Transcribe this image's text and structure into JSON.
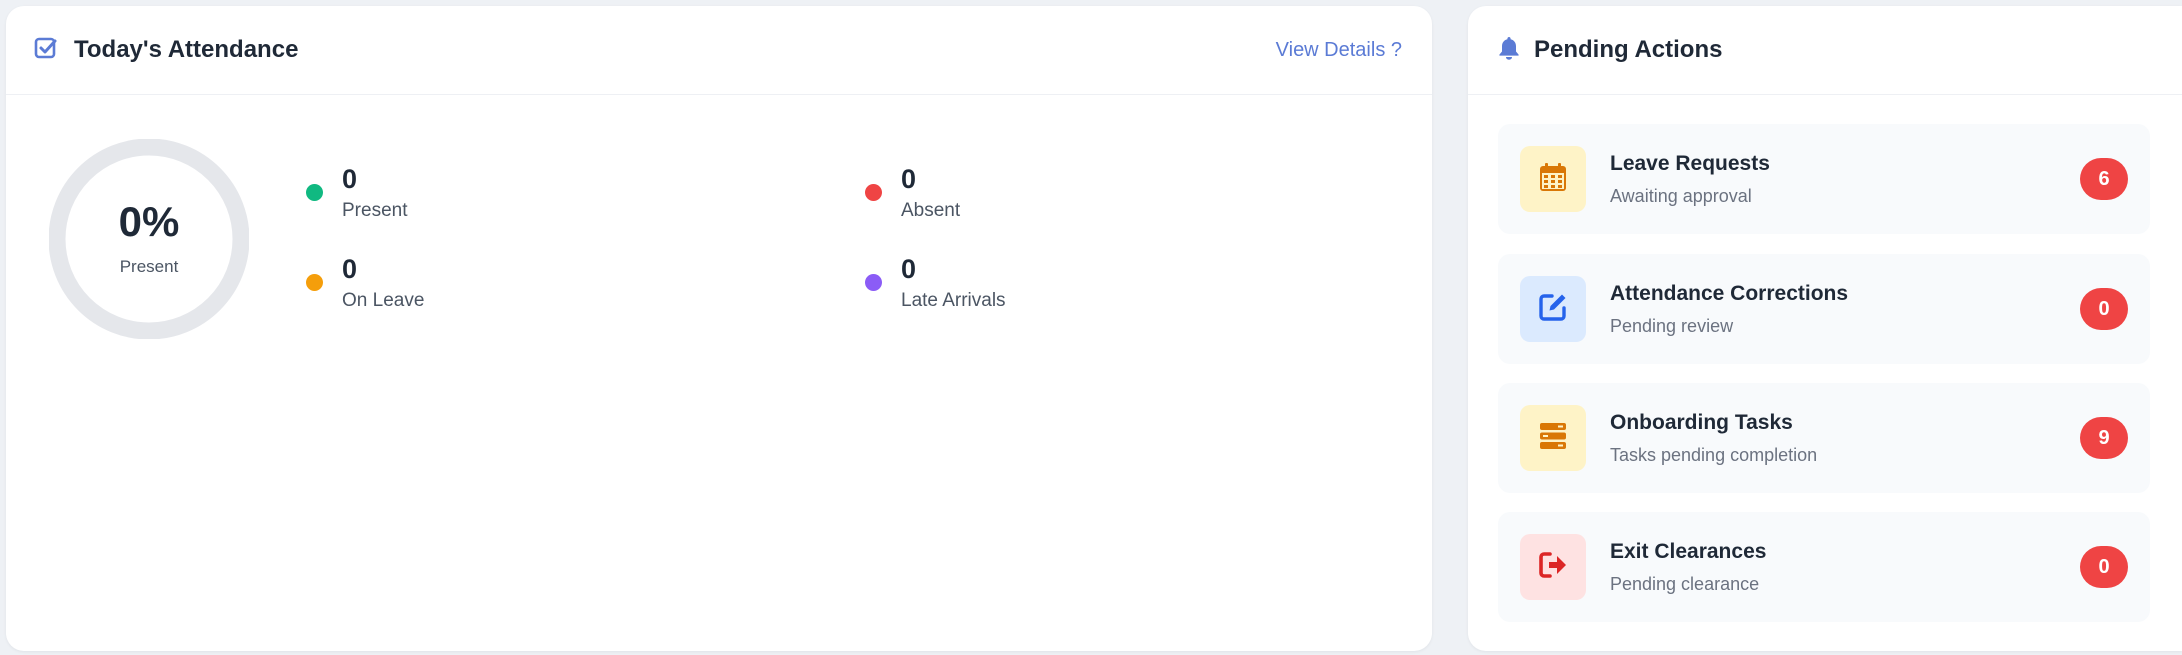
{
  "attendance": {
    "title": "Today's Attendance",
    "view_details": "View Details ?",
    "rate": {
      "value": "0%",
      "label": "Present",
      "fraction": 0
    },
    "stats": [
      {
        "value": "0",
        "label": "Present",
        "color": "#10b981"
      },
      {
        "value": "0",
        "label": "Absent",
        "color": "#ef4444"
      },
      {
        "value": "0",
        "label": "On Leave",
        "color": "#f59e0b"
      },
      {
        "value": "0",
        "label": "Late Arrivals",
        "color": "#8b5cf6"
      }
    ]
  },
  "pending": {
    "title": "Pending Actions",
    "items": [
      {
        "title": "Leave Requests",
        "subtitle": "Awaiting approval",
        "count": "6",
        "icon": "calendar-icon",
        "icon_color": "#d97706",
        "icon_bg": "#fef3c7"
      },
      {
        "title": "Attendance Corrections",
        "subtitle": "Pending review",
        "count": "0",
        "icon": "edit-icon",
        "icon_color": "#2563eb",
        "icon_bg": "#dbeafe"
      },
      {
        "title": "Onboarding Tasks",
        "subtitle": "Tasks pending completion",
        "count": "9",
        "icon": "tasks-icon",
        "icon_color": "#d97706",
        "icon_bg": "#fef3c7"
      },
      {
        "title": "Exit Clearances",
        "subtitle": "Pending clearance",
        "count": "0",
        "icon": "sign-out-icon",
        "icon_color": "#dc2626",
        "icon_bg": "#fee2e2"
      }
    ]
  },
  "colors": {
    "accent": "#5b7bd5",
    "badge": "#ef4444",
    "donut_track": "#e5e7eb"
  }
}
